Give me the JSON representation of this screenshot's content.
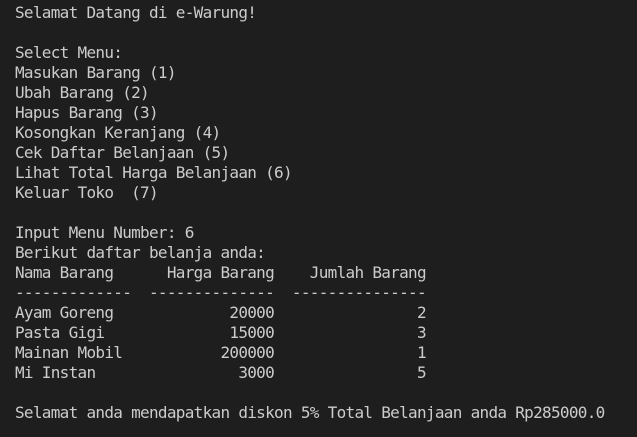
{
  "greeting": "Selamat Datang di e-Warung!",
  "menu": {
    "title": "Select Menu:",
    "items": [
      "Masukan Barang (1)",
      "Ubah Barang (2)",
      "Hapus Barang (3)",
      "Kosongkan Keranjang (4)",
      "Cek Daftar Belanjaan (5)",
      "Lihat Total Harga Belanjaan (6)",
      "Keluar Toko  (7)"
    ]
  },
  "input_prompt": "Input Menu Number: 6",
  "list_title": "Berikut daftar belanja anda:",
  "table": {
    "header": "Nama Barang      Harga Barang    Jumlah Barang",
    "separator": "-------------  --------------  ---------------",
    "rows": [
      "Ayam Goreng             20000                2",
      "Pasta Gigi              15000                3",
      "Mainan Mobil           200000                1",
      "Mi Instan                3000                5"
    ]
  },
  "summary": "Selamat anda mendapatkan diskon 5% Total Belanjaan anda Rp285000.0"
}
